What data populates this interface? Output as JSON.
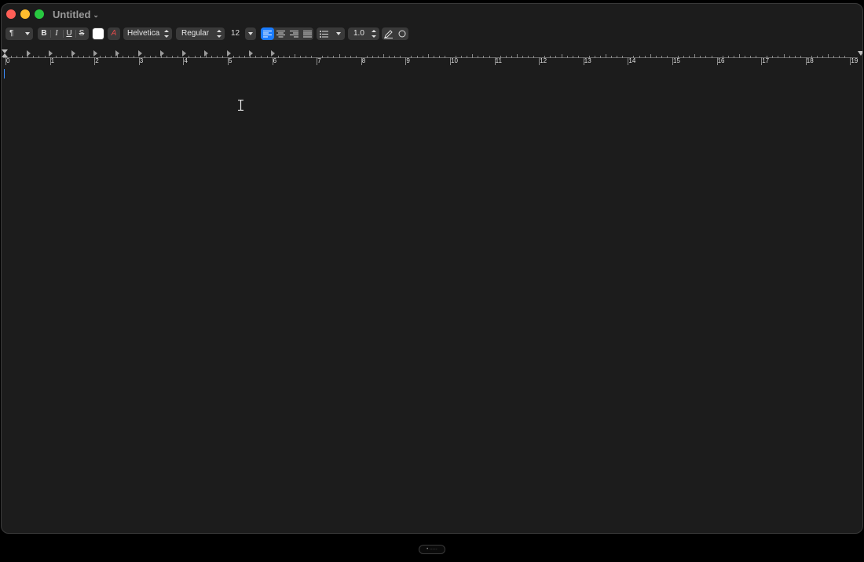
{
  "window": {
    "title": "Untitled"
  },
  "toolbar": {
    "paragraph_style_icon": "paragraph-icon",
    "bold": "B",
    "italic": "I",
    "underline": "U",
    "strike": "S",
    "text_color": "#ffffff",
    "font_family": "Helvetica",
    "font_style": "Regular",
    "font_size": "12",
    "line_spacing": "1.0",
    "accent": "#1a7cff"
  },
  "ruler": {
    "labels": [
      "0",
      "1",
      "2",
      "3",
      "4",
      "5",
      "6",
      "7",
      "8",
      "9",
      "10",
      "11",
      "12",
      "13",
      "14",
      "15",
      "16",
      "17",
      "18",
      "19"
    ]
  },
  "document": {
    "text": ""
  }
}
